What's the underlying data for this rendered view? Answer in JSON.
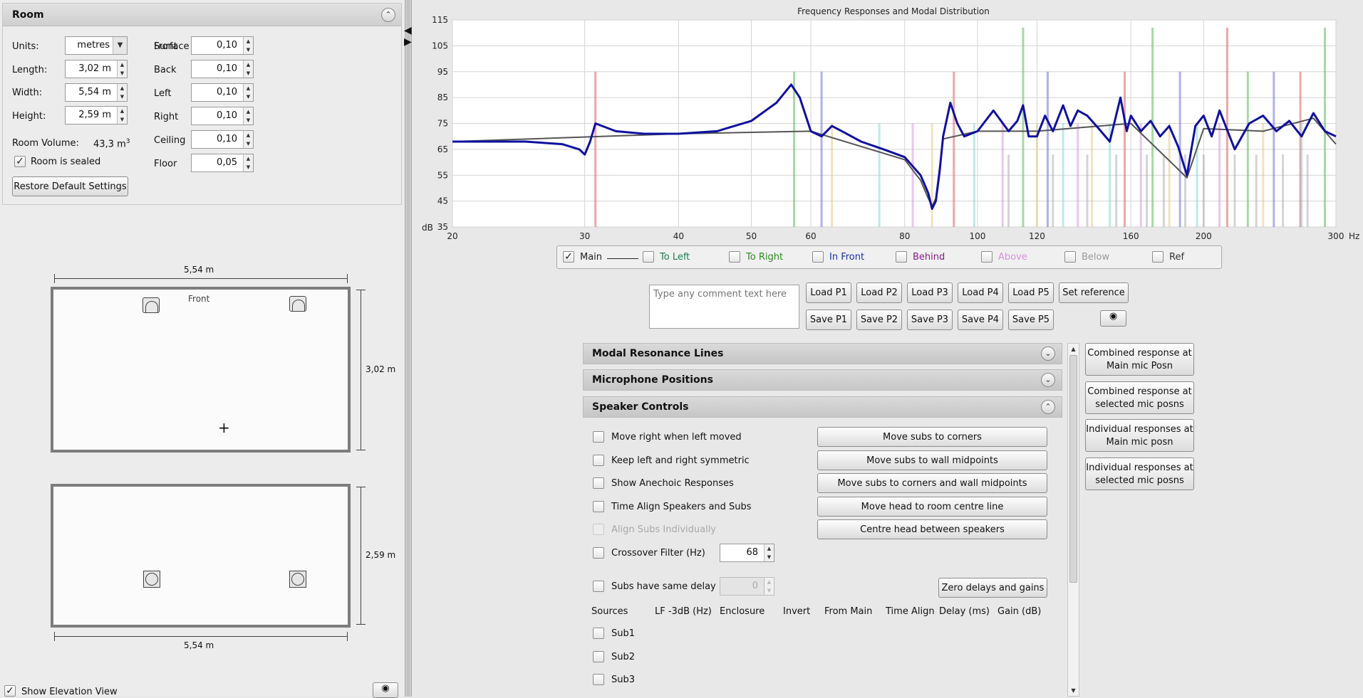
{
  "room": {
    "title": "Room",
    "units_label": "Units:",
    "units_value": "metres",
    "length_label": "Length:",
    "length_value": "3,02 m",
    "width_label": "Width:",
    "width_value": "5,54 m",
    "height_label": "Height:",
    "height_value": "2,59 m",
    "volume_label": "Room Volume:",
    "volume_value": "43,3 m",
    "volume_unit_sup": "3",
    "sealed_label": "Room is sealed",
    "sealed_checked": true,
    "restore_label": "Restore Default Settings",
    "absorptions_title": "Surface Absorptions",
    "absorptions": [
      {
        "label": "Front",
        "value": "0,10"
      },
      {
        "label": "Back",
        "value": "0,10"
      },
      {
        "label": "Left",
        "value": "0,10"
      },
      {
        "label": "Right",
        "value": "0,10"
      },
      {
        "label": "Ceiling",
        "value": "0,10"
      },
      {
        "label": "Floor",
        "value": "0,05"
      }
    ]
  },
  "plan": {
    "top_width": "5,54 m",
    "front_label": "Front",
    "depth": "3,02 m",
    "elev_height": "2,59 m",
    "bottom_width": "5,54 m",
    "show_elevation_label": "Show Elevation View",
    "show_elevation_checked": true
  },
  "chart_data": {
    "type": "line",
    "title": "Frequency Responses and Modal Distribution",
    "ylabel": "dB",
    "xlabel": "Hz",
    "xscale": "log",
    "xlim": [
      20,
      300
    ],
    "ylim": [
      35,
      115
    ],
    "grid": true,
    "x_ticks": [
      20,
      30,
      40,
      50,
      60,
      80,
      100,
      120,
      160,
      200,
      300
    ],
    "y_ticks": [
      35,
      45,
      55,
      65,
      75,
      85,
      95,
      105,
      115
    ],
    "series": [
      {
        "name": "Main",
        "color": "#1010a0",
        "x": [
          20,
          25,
          28,
          29.5,
          30,
          30.5,
          31,
          33,
          36,
          40,
          45,
          50,
          54,
          56.5,
          58,
          60,
          62,
          64,
          66,
          70,
          75,
          80,
          84,
          86,
          87,
          88,
          89,
          90,
          92,
          94,
          96,
          100,
          105,
          110,
          113,
          115,
          117,
          120,
          123,
          126,
          130,
          133,
          136,
          140,
          145,
          150,
          155,
          158,
          160,
          165,
          170,
          175,
          180,
          185,
          190,
          195,
          200,
          205,
          210,
          220,
          230,
          240,
          250,
          260,
          270,
          280,
          290,
          300
        ],
        "y": [
          68,
          68,
          67,
          65,
          63,
          68,
          75,
          72,
          71,
          71,
          72,
          76,
          83,
          90,
          85,
          72,
          70,
          74,
          72,
          68,
          65,
          62,
          55,
          48,
          42,
          45,
          56,
          70,
          83,
          75,
          70,
          72,
          80,
          72,
          76,
          82,
          70,
          70,
          78,
          72,
          82,
          74,
          80,
          78,
          73,
          68,
          85,
          72,
          78,
          72,
          76,
          70,
          74,
          66,
          55,
          74,
          78,
          70,
          80,
          65,
          75,
          78,
          72,
          76,
          70,
          79,
          72,
          70
        ]
      },
      {
        "name": "Reference",
        "color": "#555555",
        "x": [
          20,
          40,
          60,
          80,
          84,
          86,
          87,
          88,
          90,
          100,
          120,
          160,
          190,
          200,
          240,
          280,
          300
        ],
        "y": [
          68,
          71,
          72,
          61,
          53,
          46,
          43,
          46,
          69,
          72,
          72,
          75,
          54,
          73,
          72,
          77,
          67
        ]
      }
    ],
    "modal_lines": {
      "axial_x": [
        31,
        57,
        62,
        93,
        115,
        124,
        157,
        171,
        186,
        215,
        229,
        248,
        269,
        290
      ],
      "tangential_x": [
        64,
        74,
        82,
        87,
        99,
        108,
        120,
        130,
        136,
        142,
        150,
        165,
        180,
        196,
        210,
        240,
        270
      ],
      "oblique_x": [
        110,
        126,
        140,
        153,
        168,
        177,
        189,
        200,
        220,
        235,
        255,
        275
      ]
    }
  },
  "legend": [
    {
      "label": "Main",
      "checked": true,
      "color": "#222222"
    },
    {
      "label": "To Left",
      "checked": false,
      "color": "#1a7f4f"
    },
    {
      "label": "To Right",
      "checked": false,
      "color": "#2c8a1e"
    },
    {
      "label": "In Front",
      "checked": false,
      "color": "#1a2fb0"
    },
    {
      "label": "Behind",
      "checked": false,
      "color": "#8a1a8a"
    },
    {
      "label": "Above",
      "checked": false,
      "color": "#d88ee0"
    },
    {
      "label": "Below",
      "checked": false,
      "color": "#9a9a9a"
    },
    {
      "label": "Ref",
      "checked": false,
      "color": "#333333"
    }
  ],
  "comment_placeholder": "Type any comment text here",
  "load_buttons": [
    "Load P1",
    "Load P2",
    "Load P3",
    "Load P4",
    "Load P5"
  ],
  "set_reference_label": "Set reference",
  "save_buttons": [
    "Save P1",
    "Save P2",
    "Save P3",
    "Save P4",
    "Save P5"
  ],
  "sections": {
    "modal": "Modal Resonance Lines",
    "mics": "Microphone Positions",
    "speakers": "Speaker Controls"
  },
  "speaker_controls": {
    "checks": [
      {
        "label": "Move right when left moved",
        "disabled": false
      },
      {
        "label": "Keep left and right symmetric",
        "disabled": false
      },
      {
        "label": "Show Anechoic Responses",
        "disabled": false
      },
      {
        "label": "Time Align Speakers and Subs",
        "disabled": false
      },
      {
        "label": "Align Subs Individually",
        "disabled": true
      }
    ],
    "actions": [
      "Move subs to corners",
      "Move subs to wall midpoints",
      "Move subs to corners and wall midpoints",
      "Move head to room centre line",
      "Centre head between speakers"
    ],
    "crossover_label": "Crossover Filter (Hz)",
    "crossover_value": "68",
    "subs_delay_label": "Subs have same delay",
    "subs_delay_value": "0",
    "zero_label": "Zero delays and gains",
    "columns": [
      "Sources",
      "LF -3dB (Hz)",
      "Enclosure",
      "Invert",
      "From Main",
      "Time Align",
      "Delay (ms)",
      "Gain (dB)"
    ],
    "subs": [
      "Sub1",
      "Sub2",
      "Sub3"
    ]
  },
  "side_buttons": [
    [
      "Combined response at",
      "Main mic Posn"
    ],
    [
      "Combined response at",
      "selected mic posns"
    ],
    [
      "Individual responses at",
      "Main mic posn"
    ],
    [
      "Individual responses at",
      "selected mic posns"
    ]
  ]
}
